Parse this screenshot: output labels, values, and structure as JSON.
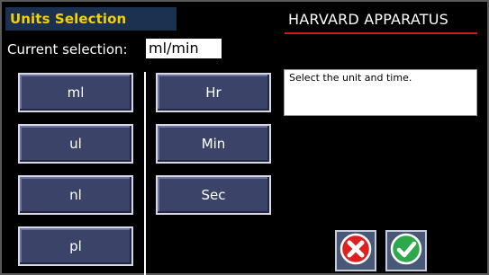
{
  "header": {
    "title": "Units Selection",
    "brand": "HARVARD APPARATUS"
  },
  "current": {
    "label": "Current selection:",
    "value": "ml/min"
  },
  "units": [
    "ml",
    "ul",
    "nl",
    "pl"
  ],
  "times": [
    "Hr",
    "Min",
    "Sec"
  ],
  "info": {
    "text": "Select the unit and time."
  },
  "actions": {
    "cancel_icon": "red-x-circle-icon",
    "confirm_icon": "green-check-circle-icon"
  },
  "colors": {
    "title": "#f2d200",
    "button": "#3b4468",
    "brand_underline": "#d01818",
    "cancel": "#e02020",
    "confirm": "#2da84a"
  }
}
